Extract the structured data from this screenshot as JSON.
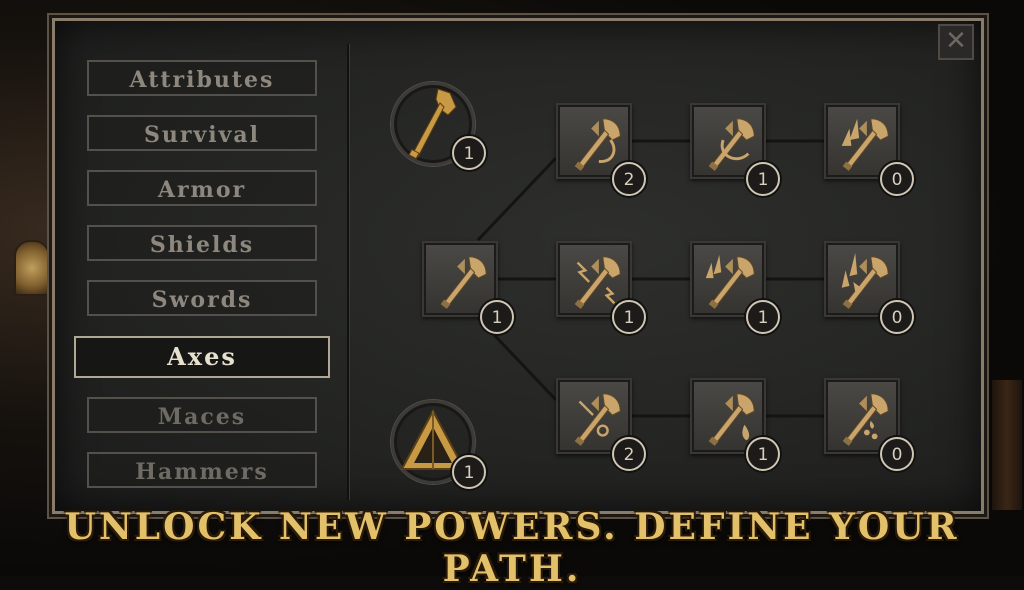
{
  "categories": {
    "attributes": "Attributes",
    "survival": "Survival",
    "armor": "Armor",
    "shields": "Shields",
    "swords": "Swords",
    "axes": "Axes",
    "maces": "Maces",
    "hammers": "Hammers",
    "selected": "Axes"
  },
  "close_glyph": "✕",
  "header_nodes": {
    "axe_mastery": {
      "icon": "golden-axe-icon",
      "count": "1"
    },
    "pyramid": {
      "icon": "pyramid-icon",
      "count": "1"
    }
  },
  "skill_tree": {
    "root": {
      "icon": "axe-icon",
      "count": "1"
    },
    "top_row": [
      {
        "icon": "axe-hook-icon",
        "count": "2"
      },
      {
        "icon": "axe-swirl-icon",
        "count": "1"
      },
      {
        "icon": "axe-blades-icon",
        "count": "0"
      }
    ],
    "middle_row": [
      {
        "icon": "axe-lightning-icon",
        "count": "1"
      },
      {
        "icon": "axe-shards-icon",
        "count": "1"
      },
      {
        "icon": "axe-spikes-icon",
        "count": "0"
      }
    ],
    "bottom_row": [
      {
        "icon": "axe-chain-icon",
        "count": "2"
      },
      {
        "icon": "axe-blood-icon",
        "count": "1"
      },
      {
        "icon": "axe-drops-icon",
        "count": "0"
      }
    ]
  },
  "colors": {
    "accent_gold": "#e3c06a",
    "icon_bronze": "#c9a56c",
    "panel_border": "#8a7c6a"
  },
  "tagline": "UNLOCK NEW POWERS. DEFINE YOUR PATH."
}
